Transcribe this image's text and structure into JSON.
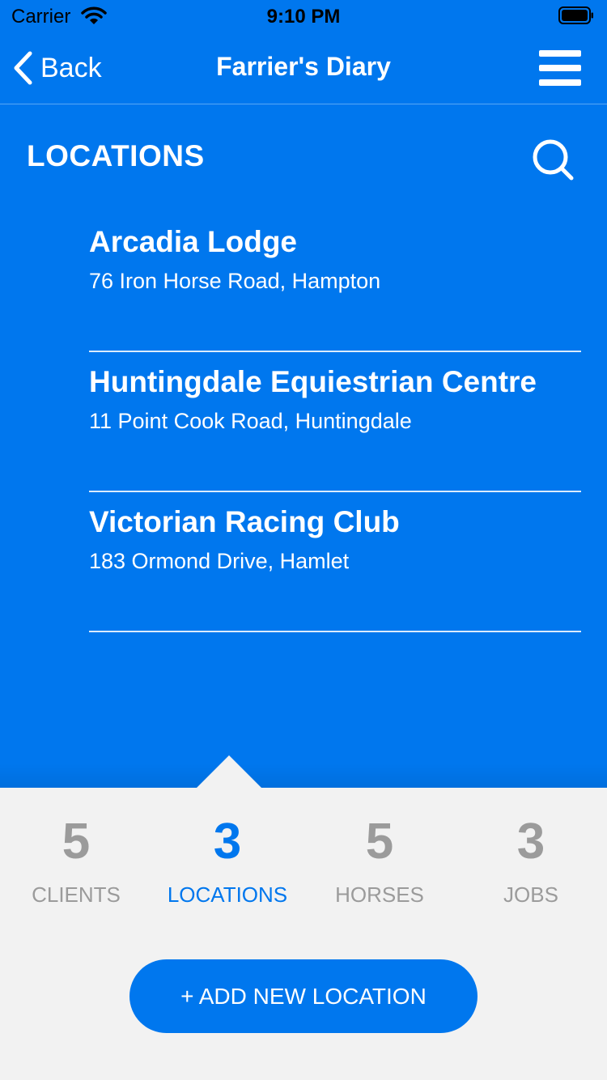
{
  "status": {
    "carrier": "Carrier",
    "time": "9:10 PM"
  },
  "nav": {
    "back_label": "Back",
    "title": "Farrier's Diary"
  },
  "section": {
    "title": "LOCATIONS"
  },
  "locations": [
    {
      "name": "Arcadia Lodge",
      "address": "76 Iron Horse Road, Hampton"
    },
    {
      "name": "Huntingdale Equiestrian Centre",
      "address": "11 Point Cook Road, Huntingdale"
    },
    {
      "name": "Victorian Racing Club",
      "address": "183 Ormond Drive, Hamlet"
    }
  ],
  "stats": [
    {
      "count": "5",
      "label": "CLIENTS",
      "active": false
    },
    {
      "count": "3",
      "label": "LOCATIONS",
      "active": true
    },
    {
      "count": "5",
      "label": "HORSES",
      "active": false
    },
    {
      "count": "3",
      "label": "JOBS",
      "active": false
    }
  ],
  "add_button": {
    "label": "+ ADD NEW LOCATION"
  },
  "icons": {
    "back": "chevron-left-icon",
    "menu": "hamburger-menu-icon",
    "search": "search-icon",
    "wifi": "wifi-icon",
    "battery": "battery-icon"
  },
  "colors": {
    "primary": "#0077ee",
    "inactive": "#9b9b9b",
    "panel": "#f2f2f2"
  }
}
